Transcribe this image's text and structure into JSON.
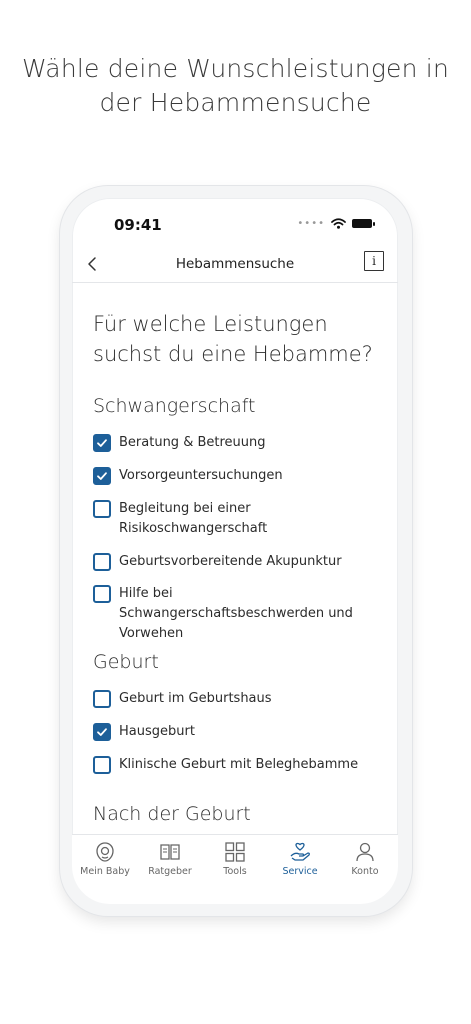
{
  "headline": "Wähle deine Wunschleistungen in der Hebammensuche",
  "status": {
    "time": "09:41"
  },
  "nav": {
    "title": "Hebammensuche",
    "info_label": "i"
  },
  "question": "Für welche Leistungen suchst du eine Hebamme?",
  "sections": [
    {
      "title": "Schwangerschaft",
      "options": [
        {
          "label": "Beratung & Betreuung",
          "checked": true
        },
        {
          "label": "Vorsorgeuntersuchungen",
          "checked": true
        },
        {
          "label": "Begleitung bei einer Risikoschwangerschaft",
          "checked": false
        },
        {
          "label": "Geburtsvorbereitende Akupunktur",
          "checked": false
        },
        {
          "label": "Hilfe bei Schwangerschaftsbeschwerden und Vorwehen",
          "checked": false
        }
      ]
    },
    {
      "title": "Geburt",
      "options": [
        {
          "label": "Geburt im Geburtshaus",
          "checked": false
        },
        {
          "label": "Hausgeburt",
          "checked": true
        },
        {
          "label": "Klinische Geburt mit Beleghebamme",
          "checked": false
        }
      ]
    },
    {
      "title": "Nach der Geburt",
      "options": []
    }
  ],
  "tabs": [
    {
      "label": "Mein Baby",
      "icon": "baby-icon",
      "active": false
    },
    {
      "label": "Ratgeber",
      "icon": "book-icon",
      "active": false
    },
    {
      "label": "Tools",
      "icon": "grid-icon",
      "active": false
    },
    {
      "label": "Service",
      "icon": "heart-hand-icon",
      "active": true
    },
    {
      "label": "Konto",
      "icon": "person-icon",
      "active": false
    }
  ],
  "colors": {
    "accent": "#1d5f99",
    "text": "#2b2b2b",
    "divider": "#e4e6e9"
  }
}
